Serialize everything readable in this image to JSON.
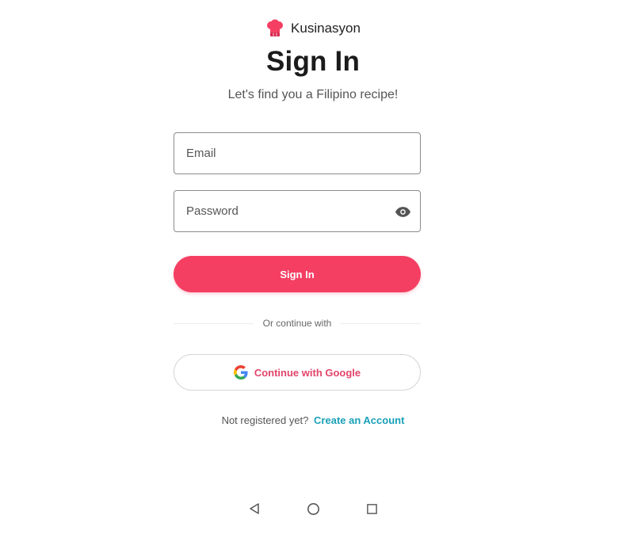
{
  "brand": {
    "name": "Kusinasyon",
    "logo_icon": "chef-hat-icon",
    "accent": "#f43f63"
  },
  "header": {
    "title": "Sign In",
    "subtitle": "Let's find you a Filipino recipe!"
  },
  "form": {
    "email": {
      "placeholder": "Email",
      "value": ""
    },
    "password": {
      "placeholder": "Password",
      "value": "",
      "toggle_icon": "eye-icon"
    },
    "submit_label": "Sign In"
  },
  "divider": {
    "text": "Or continue with"
  },
  "google": {
    "label": "Continue with Google",
    "icon": "google-g-icon",
    "label_color": "#e2456a"
  },
  "register": {
    "prompt": "Not registered yet?",
    "link_label": "Create an Account",
    "link_color": "#1aa0b8"
  },
  "system_nav": {
    "back_icon": "back-triangle-icon",
    "home_icon": "home-circle-icon",
    "recents_icon": "recents-square-icon"
  }
}
